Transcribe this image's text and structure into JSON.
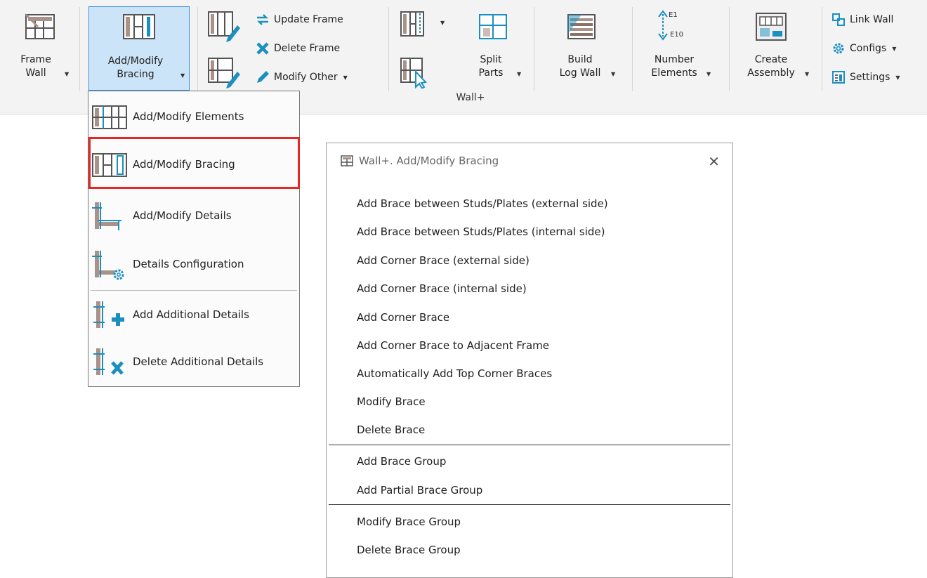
{
  "ribbon": {
    "frame_wall": "Frame\nWall",
    "add_modify_bracing": "Add/Modify\nBracing",
    "update_frame": "Update Frame",
    "delete_frame": "Delete Frame",
    "modify_other": "Modify Other",
    "split_parts": "Split\nParts",
    "build_log_wall": "Build\nLog Wall",
    "number_elements": "Number\nElements",
    "number_icon_top": "E1",
    "number_icon_bottom": "E10",
    "create_assembly": "Create\nAssembly",
    "link_wall": "Link Wall",
    "configs": "Configs",
    "settings": "Settings",
    "group_label": "Wall+"
  },
  "dropdown": {
    "items": [
      {
        "label": "Add/Modify  Elements"
      },
      {
        "label": "Add/Modify  Bracing"
      },
      {
        "label": "Add/Modify  Details"
      },
      {
        "label": "Details  Configuration"
      },
      {
        "label": "Add Additional  Details"
      },
      {
        "label": "Delete Additional  Details"
      }
    ]
  },
  "dialog": {
    "title": "Wall+. Add/Modify Bracing",
    "options": [
      "Add Brace between Studs/Plates (external side)",
      "Add Brace between Studs/Plates (internal side)",
      "Add Corner Brace (external side)",
      "Add Corner Brace (internal side)",
      "Add Corner Brace",
      "Add Corner Brace to Adjacent Frame",
      "Automatically Add Top Corner Braces",
      "Modify Brace",
      "Delete Brace",
      "Add Brace Group",
      "Add Partial Brace Group",
      "Modify Brace Group",
      "Delete Brace Group"
    ]
  },
  "colors": {
    "accent": "#1a8fc0",
    "wood": "#a9928a",
    "selection_bg": "#cce4f7",
    "highlight": "#e32828"
  }
}
